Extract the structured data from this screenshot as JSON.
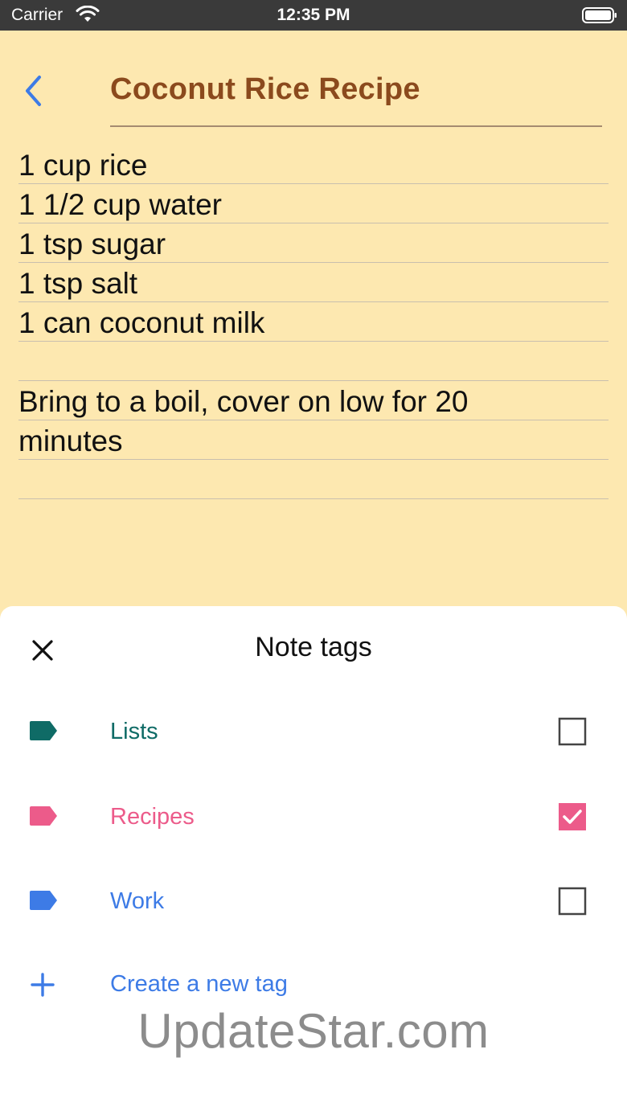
{
  "status_bar": {
    "carrier": "Carrier",
    "time": "12:35 PM",
    "icons": [
      "wifi-icon",
      "battery-icon"
    ]
  },
  "note": {
    "title": "Coconut Rice Recipe",
    "lines": [
      "1 cup rice",
      "1 1/2 cup water",
      "1 tsp sugar",
      "1 tsp salt",
      "1 can coconut milk",
      "",
      "Bring to a boil, cover on low for 20",
      "minutes",
      ""
    ],
    "background_color": "#fde8b0",
    "title_color": "#8b4a1d"
  },
  "sheet": {
    "title": "Note tags",
    "close_icon": "close-icon",
    "tags": [
      {
        "label": "Lists",
        "color": "#0f6b66",
        "checked": false
      },
      {
        "label": "Recipes",
        "color": "#ec5b8a",
        "checked": true
      },
      {
        "label": "Work",
        "color": "#3d7be6",
        "checked": false
      }
    ],
    "create_label": "Create a new tag"
  },
  "watermark": "UpdateStar.com"
}
